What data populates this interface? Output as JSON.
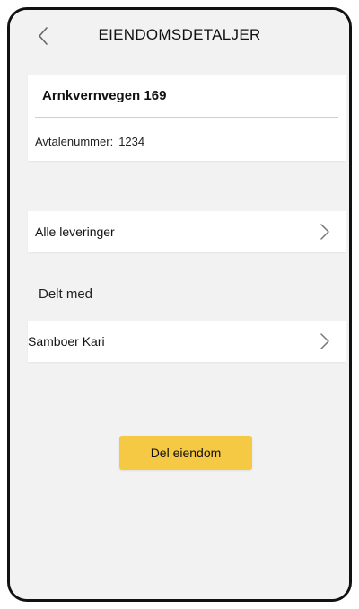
{
  "header": {
    "title": "EIENDOMSDETALJER",
    "back_icon": "chevron-left-icon"
  },
  "property": {
    "name": "Arnkvernvegen 169",
    "agreement_label": "Avtalenummer:",
    "agreement_number": "1234"
  },
  "deliveries": {
    "label": "Alle leveringer",
    "icon": "chevron-right-icon"
  },
  "shared_section": {
    "label": "Delt med",
    "items": [
      {
        "label": "Samboer Kari",
        "icon": "chevron-right-icon"
      }
    ]
  },
  "actions": {
    "share_label": "Del eiendom",
    "share_color": "#f6c945"
  },
  "colors": {
    "background": "#f2f2f2",
    "card": "#ffffff",
    "accent": "#f6c945"
  }
}
